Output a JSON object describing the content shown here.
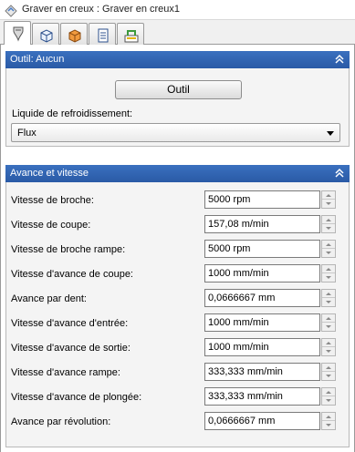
{
  "window": {
    "title": "Graver en creux : Graver en creux1",
    "title_icon": "engrave-document-icon"
  },
  "tabs": [
    {
      "name": "tool-tab",
      "icon": "tool-bit-icon",
      "active": true
    },
    {
      "name": "geometry-tab",
      "icon": "wireframe-box-icon",
      "active": false
    },
    {
      "name": "stock-tab",
      "icon": "orange-box-icon",
      "active": false
    },
    {
      "name": "passes-tab",
      "icon": "passes-list-icon",
      "active": false
    },
    {
      "name": "linking-tab",
      "icon": "linking-icon",
      "active": false
    }
  ],
  "tool_panel": {
    "title": "Outil: Aucun",
    "button_label": "Outil",
    "coolant_label": "Liquide de refroidissement:",
    "coolant_value": "Flux"
  },
  "feed_panel": {
    "title": "Avance et vitesse",
    "rows": [
      {
        "label": "Vitesse de broche:",
        "value": "5000 rpm"
      },
      {
        "label": "Vitesse de coupe:",
        "value": "157,08 m/min"
      },
      {
        "label": "Vitesse de broche rampe:",
        "value": "5000 rpm"
      },
      {
        "label": "Vitesse d'avance de coupe:",
        "value": "1000 mm/min"
      },
      {
        "label": "Avance par dent:",
        "value": "0,0666667 mm"
      },
      {
        "label": "Vitesse d'avance d'entrée:",
        "value": "1000 mm/min"
      },
      {
        "label": "Vitesse d'avance de sortie:",
        "value": "1000 mm/min"
      },
      {
        "label": "Vitesse d'avance rampe:",
        "value": "333,333 mm/min"
      },
      {
        "label": "Vitesse d'avance de plongée:",
        "value": "333,333 mm/min"
      },
      {
        "label": "Avance par révolution:",
        "value": "0,0666667 mm"
      }
    ]
  },
  "colors": {
    "panel_header": "#2f62b0",
    "panel_body": "#f4f4f4"
  }
}
